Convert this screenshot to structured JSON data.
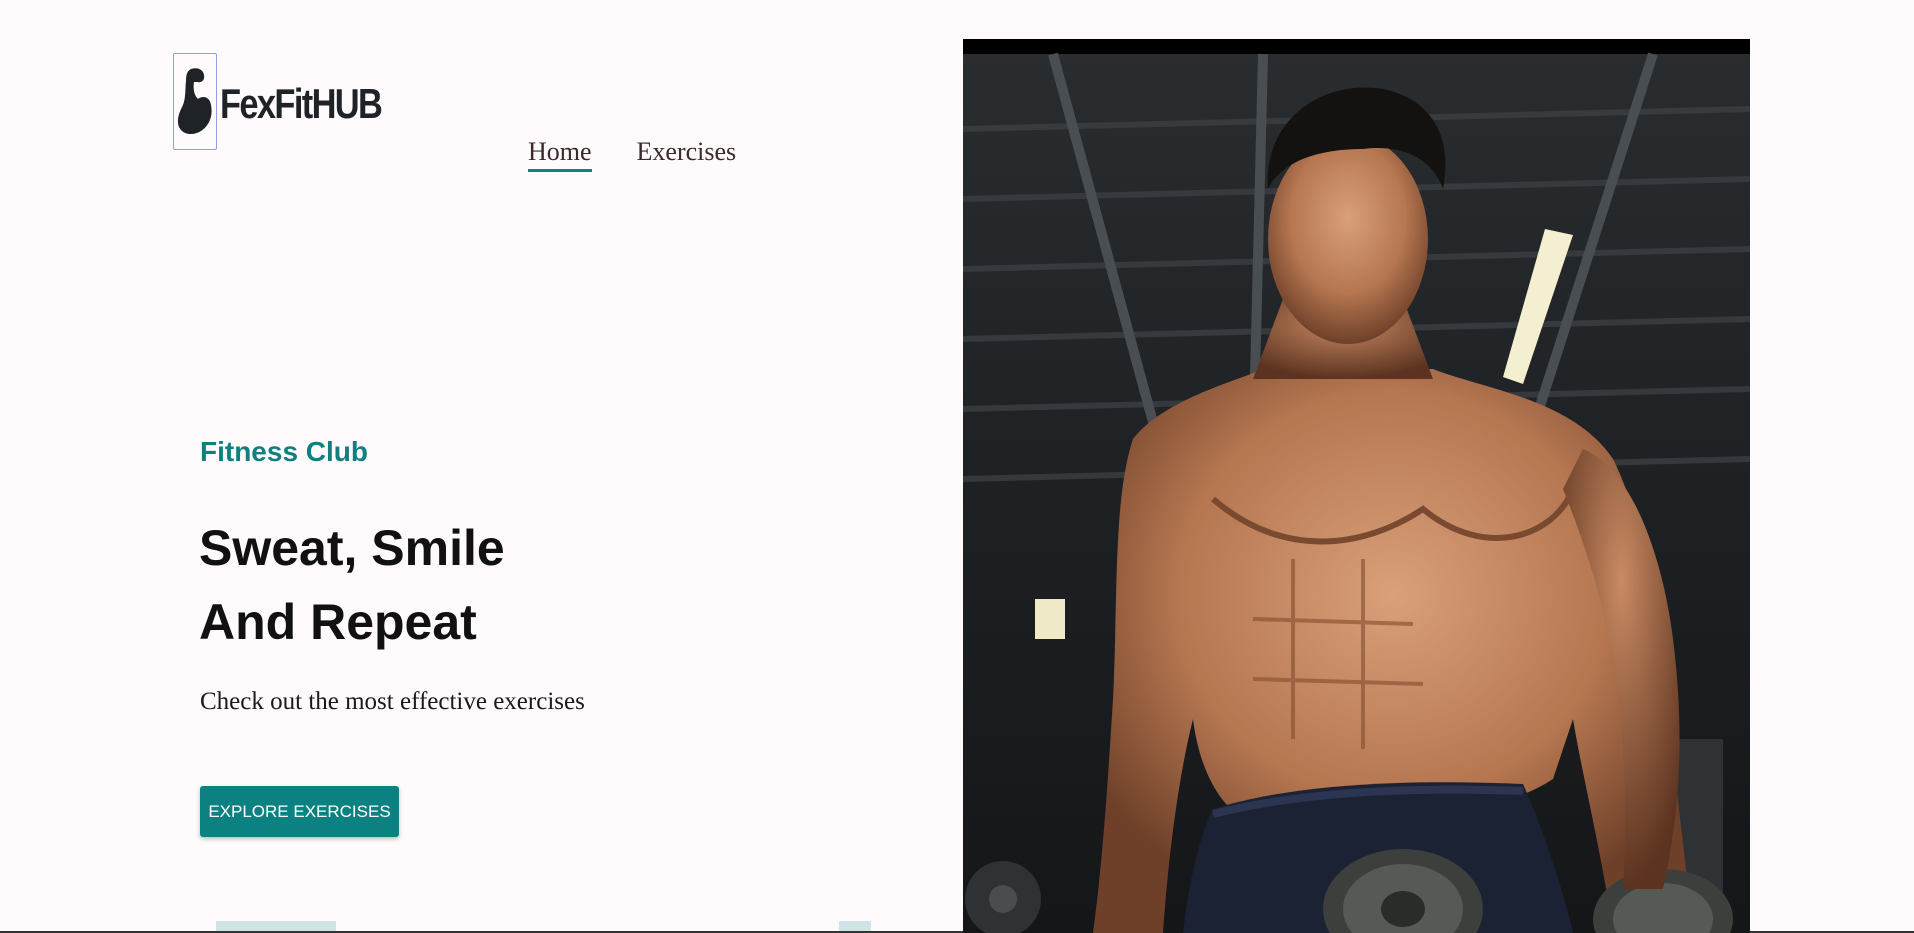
{
  "brand": {
    "name": "FexFitHUB",
    "logo_icon": "flexed-arm-icon"
  },
  "nav": {
    "items": [
      {
        "label": "Home",
        "active": true
      },
      {
        "label": "Exercises",
        "active": false
      }
    ]
  },
  "hero": {
    "tagline": "Fitness Club",
    "title_line1": "Sweat, Smile",
    "title_line2": "And Repeat",
    "subtitle": "Check out the most effective exercises",
    "cta_label": "EXPLORE EXERCISES",
    "image_alt": "muscular man lifting dumbbell in gym"
  },
  "colors": {
    "accent": "#0b8281",
    "background": "#fffafb",
    "text": "#111111"
  }
}
